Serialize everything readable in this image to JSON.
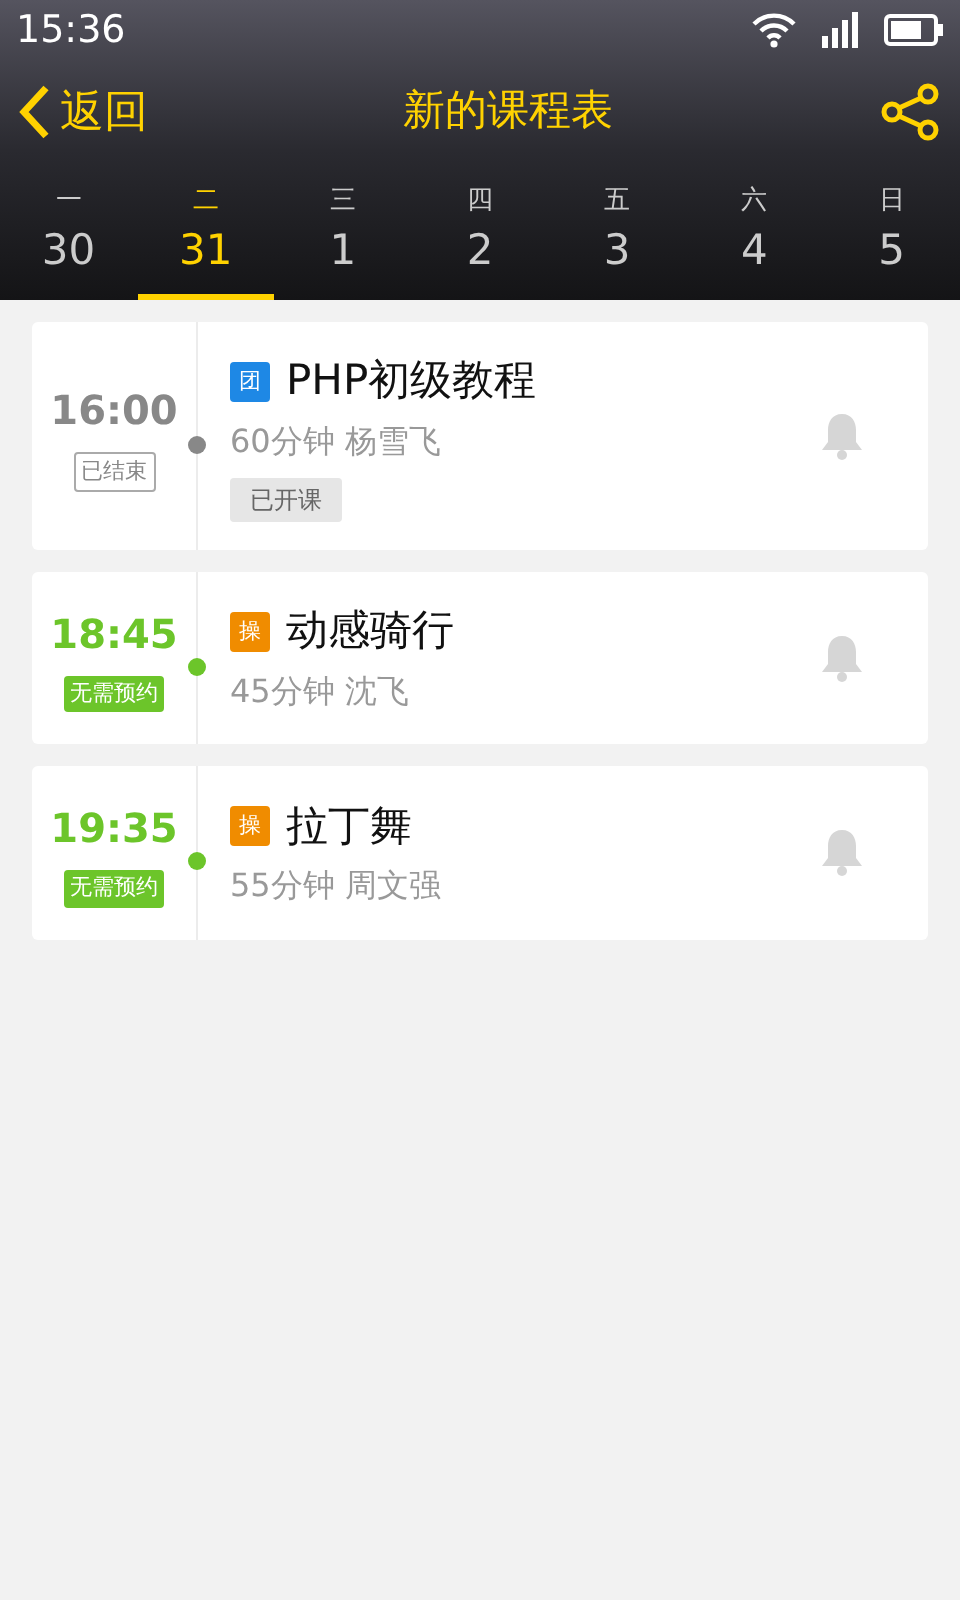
{
  "status_bar": {
    "time": "15:36"
  },
  "header": {
    "back": "返回",
    "title": "新的课程表"
  },
  "days": [
    {
      "weekday": "一",
      "date": "30",
      "selected": false
    },
    {
      "weekday": "二",
      "date": "31",
      "selected": true
    },
    {
      "weekday": "三",
      "date": "1",
      "selected": false
    },
    {
      "weekday": "四",
      "date": "2",
      "selected": false
    },
    {
      "weekday": "五",
      "date": "3",
      "selected": false
    },
    {
      "weekday": "六",
      "date": "4",
      "selected": false
    },
    {
      "weekday": "日",
      "date": "5",
      "selected": false
    }
  ],
  "classes": [
    {
      "time": "16:00",
      "status": "已结束",
      "kind": "ended",
      "type_badge": "团",
      "color": "#1e88e5",
      "title": "PHP初级教程",
      "details": "60分钟 杨雪飞",
      "tag": "已开课"
    },
    {
      "time": "18:45",
      "status": "无需预约",
      "kind": "open",
      "type_badge": "操",
      "color": "#f08c00",
      "title": "动感骑行",
      "details": "45分钟 沈飞"
    },
    {
      "time": "19:35",
      "status": "无需预约",
      "kind": "open",
      "type_badge": "操",
      "color": "#f08c00",
      "title": "拉丁舞",
      "details": "55分钟 周文强"
    }
  ]
}
